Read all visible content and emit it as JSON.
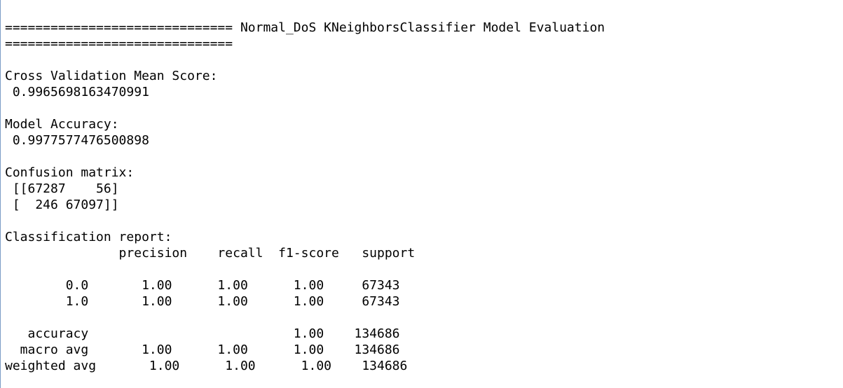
{
  "output": {
    "lines": [
      "============================== Normal_DoS KNeighborsClassifier Model Evaluation",
      "==============================",
      "",
      "Cross Validation Mean Score:",
      " 0.9965698163470991",
      "",
      "Model Accuracy:",
      " 0.9977577476500898",
      "",
      "Confusion matrix:",
      " [[67287    56]",
      " [  246 67097]]",
      "",
      "Classification report:",
      "               precision    recall  f1-score   support",
      "",
      "        0.0       1.00      1.00      1.00     67343",
      "        1.0       1.00      1.00      1.00     67343",
      "",
      "   accuracy                           1.00    134686",
      "  macro avg       1.00      1.00      1.00    134686",
      "weighted avg       1.00      1.00      1.00    134686"
    ]
  }
}
